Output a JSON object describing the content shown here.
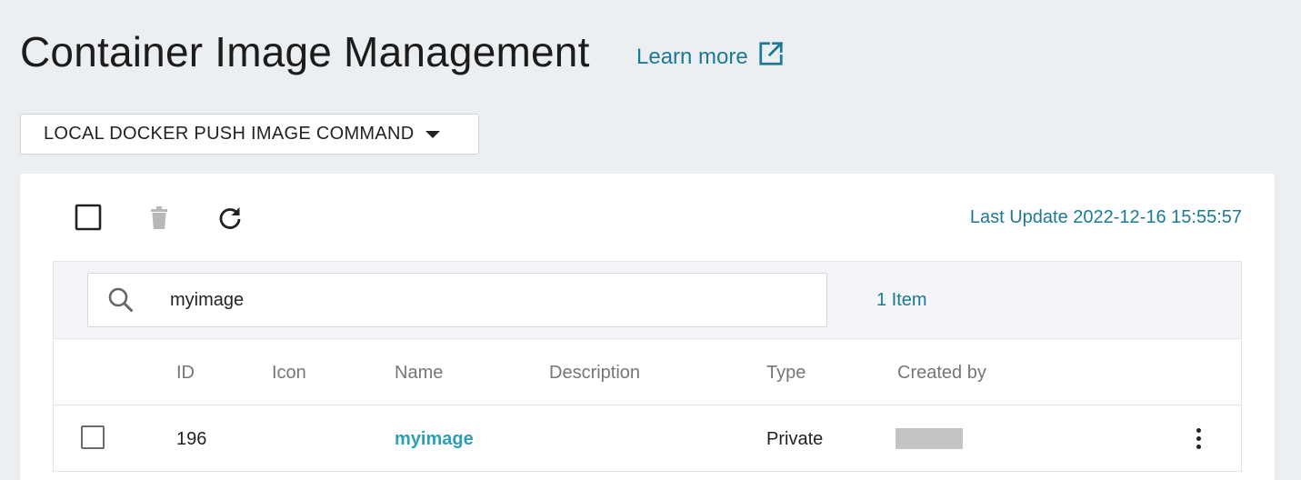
{
  "header": {
    "title": "Container Image Management",
    "learn_more": "Learn more",
    "learn_more_icon": "external-link-icon"
  },
  "command_dropdown": {
    "label": "LOCAL DOCKER PUSH IMAGE COMMAND"
  },
  "toolbar": {
    "select_all_icon": "checkbox-icon",
    "delete_icon": "trash-icon",
    "refresh_icon": "refresh-icon",
    "last_update": "Last Update 2022-12-16 15:55:57"
  },
  "search": {
    "value": "myimage",
    "icon": "search-icon"
  },
  "item_count": "1 Item",
  "table": {
    "columns": [
      "ID",
      "Icon",
      "Name",
      "Description",
      "Type",
      "Created by"
    ],
    "rows": [
      {
        "id": "196",
        "icon": "",
        "name": "myimage",
        "description": "",
        "type": "Private",
        "created_by": ""
      }
    ]
  },
  "colors": {
    "accent": "#1a7a96",
    "link": "#2aa0b5",
    "background": "#eceff2"
  }
}
